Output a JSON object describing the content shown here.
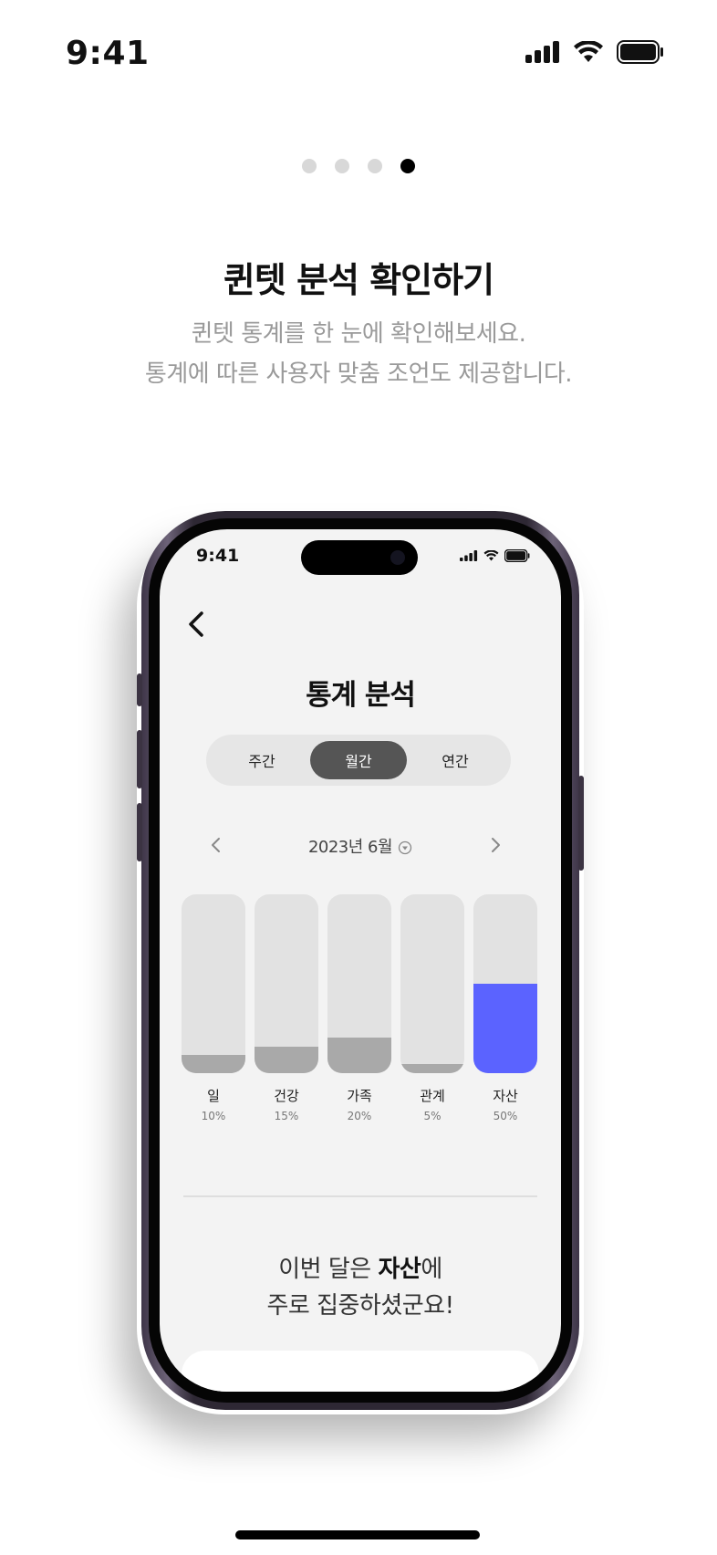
{
  "status_bar": {
    "time": "9:41"
  },
  "pagination": {
    "total": 4,
    "active": 3
  },
  "intro": {
    "title": "퀸텟 분석 확인하기",
    "subtitle_line1": "퀸텟 통계를 한 눈에 확인해보세요.",
    "subtitle_line2": "통계에 따른 사용자 맞춤 조언도 제공합니다."
  },
  "mockup": {
    "status_time": "9:41",
    "title": "통계 분석",
    "tabs": [
      {
        "label": "주간",
        "active": false
      },
      {
        "label": "월간",
        "active": true
      },
      {
        "label": "연간",
        "active": false
      }
    ],
    "month_label": "2023년 6월",
    "summary_line1_pre": "이번 달은 ",
    "summary_line1_bold": "자산",
    "summary_line1_post": "에",
    "summary_line2": "주로 집중하셨군요!"
  },
  "chart_data": {
    "type": "bar",
    "categories": [
      "일",
      "건강",
      "가족",
      "관계",
      "자산"
    ],
    "values": [
      10,
      15,
      20,
      5,
      50
    ],
    "value_labels": [
      "10%",
      "15%",
      "20%",
      "5%",
      "50%"
    ],
    "ylim": [
      0,
      100
    ],
    "highlight_category": "자산",
    "colors": {
      "default": "#a9a9a9",
      "highlight": "#5b63ff",
      "track": "#e2e2e2"
    }
  }
}
